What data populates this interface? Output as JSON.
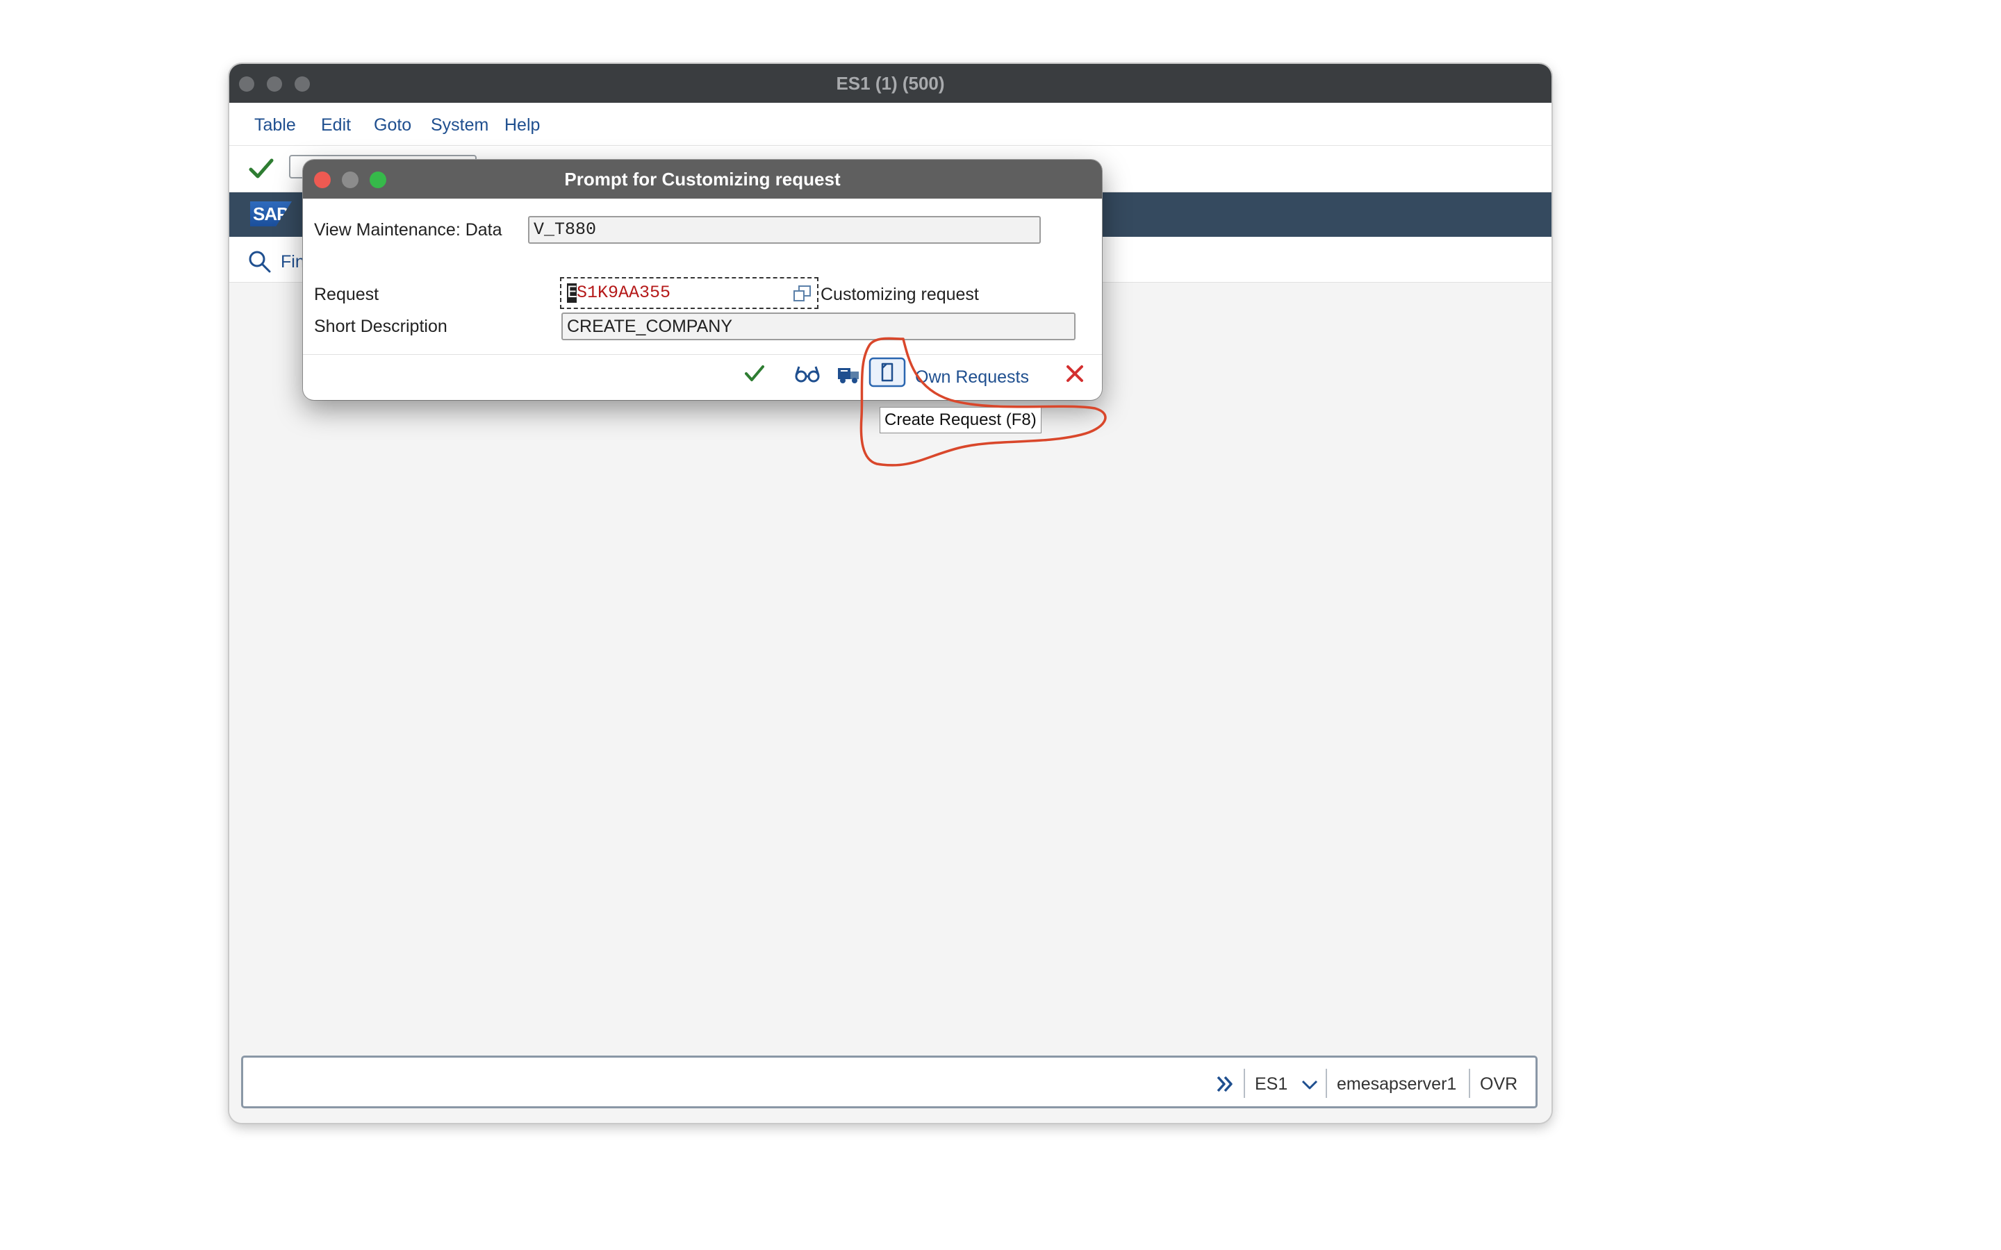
{
  "window": {
    "title": "ES1 (1) (500)"
  },
  "menu": {
    "items": [
      "Table",
      "Edit",
      "Goto",
      "System",
      "Help"
    ]
  },
  "subtoolbar": {
    "find_label": "Fin"
  },
  "dialog": {
    "title": "Prompt for Customizing request",
    "view_label": "View Maintenance: Data",
    "view_value": "V_T880",
    "request_label": "Request",
    "request_value": "S1K9AA355",
    "request_cursor_char": "E",
    "request_type": "Customizing request",
    "short_desc_label": "Short Description",
    "short_desc_value": "CREATE_COMPANY",
    "own_requests_label": "Own Requests",
    "tooltip": "Create Request (F8)"
  },
  "statusbar": {
    "system": "ES1",
    "server": "emesapserver1",
    "mode": "OVR"
  },
  "icons": {
    "toolbar": [
      "check-icon"
    ],
    "dialog_buttons": [
      "check-icon",
      "glasses-icon",
      "truck-icon",
      "create-request-icon",
      "close-x-icon"
    ]
  },
  "colors": {
    "header_band": "#354a5f",
    "request_text": "#b51a1a",
    "annotation": "#d9472b",
    "link": "#1f4f8f"
  }
}
